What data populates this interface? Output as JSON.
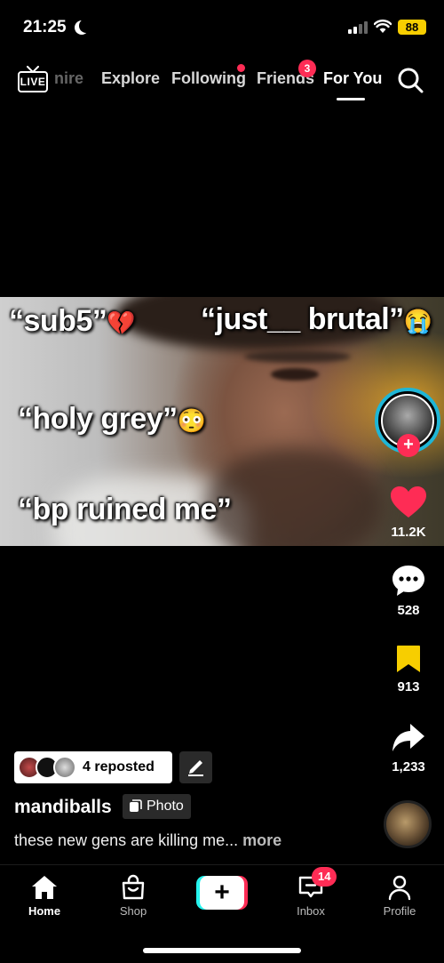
{
  "status_bar": {
    "time": "21:25",
    "battery": "88"
  },
  "top_nav": {
    "live_label": "LIVE",
    "tabs": [
      "nire",
      "Explore",
      "Following",
      "Friends",
      "For You"
    ],
    "friends_badge": "3"
  },
  "photo_captions": {
    "c1": "“sub5”",
    "c1_emoji": "💔",
    "c2": "“just__ brutal”",
    "c2_emoji": "😭",
    "c3": "“holy grey”",
    "c3_emoji": "😳",
    "c4": "“bp ruined me”"
  },
  "actions": {
    "likes": "11.2K",
    "comments": "528",
    "bookmarks": "913",
    "shares": "1,233"
  },
  "post": {
    "repost_text": "4 reposted",
    "username": "mandiballs",
    "type_tag": "Photo",
    "description": "these new gens are killing me...",
    "more": "more"
  },
  "bottom_nav": {
    "home": "Home",
    "shop": "Shop",
    "inbox": "Inbox",
    "inbox_badge": "14",
    "profile": "Profile"
  },
  "colors": {
    "accent_red": "#fe2c55",
    "accent_cyan": "#25f4ee",
    "bookmark_yellow": "#f7ce00"
  }
}
